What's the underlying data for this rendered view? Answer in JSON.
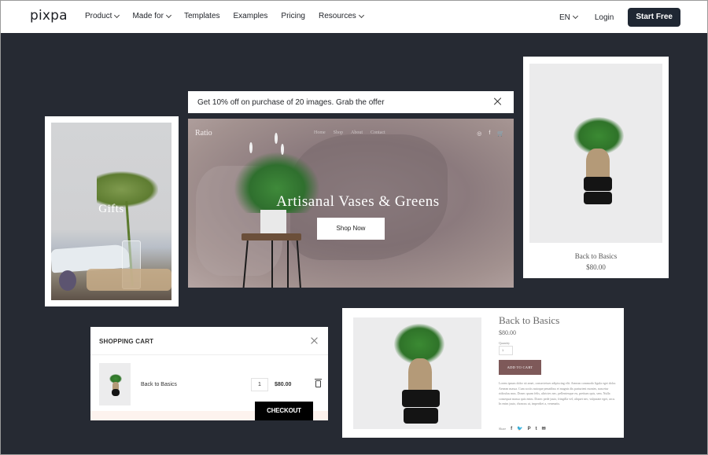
{
  "topnav": {
    "logo": "pixpa",
    "links": [
      {
        "label": "Product",
        "dropdown": true
      },
      {
        "label": "Made for",
        "dropdown": true
      },
      {
        "label": "Templates",
        "dropdown": false
      },
      {
        "label": "Examples",
        "dropdown": false
      },
      {
        "label": "Pricing",
        "dropdown": false
      },
      {
        "label": "Resources",
        "dropdown": true
      }
    ],
    "language": "EN",
    "login": "Login",
    "cta": "Start Free"
  },
  "gifts_card": {
    "label": "Gifts"
  },
  "promo_banner": {
    "text": "Get 10% off on purchase of 20 images. Grab the offer",
    "close_icon": "close-icon"
  },
  "hero": {
    "brand": "Ratio",
    "menu": [
      "Home",
      "Shop",
      "About",
      "Contact"
    ],
    "icons": [
      "instagram-icon",
      "facebook-icon",
      "cart-icon"
    ],
    "icon_glyphs": [
      "◎",
      "f",
      "🛒"
    ],
    "title": "Artisanal Vases & Greens",
    "button": "Shop Now"
  },
  "product_card": {
    "name": "Back to Basics",
    "price": "$80.00"
  },
  "cart": {
    "title": "SHOPPING CART",
    "item": {
      "name": "Back to Basics",
      "quantity": "1",
      "price": "$80.00"
    },
    "checkout": "CHECKOUT"
  },
  "product_detail": {
    "title": "Back to Basics",
    "price": "$80.00",
    "quantity_label": "Quantity",
    "quantity": "1",
    "add_to_cart": "ADD TO CART",
    "description": "Lorem ipsum dolor sit amet, consectetuer adipiscing elit. Aenean commodo ligula eget dolor. Aenean massa. Cum sociis natoque penatibus et magnis dis parturient montes, nascetur ridiculus mus. Donec quam felis, ultricies nec, pellentesque eu, pretium quis, sem. Nulla consequat massa quis enim. Donec pede justo, fringilla vel, aliquet nec, vulputate eget, arcu. In enim justo, rhoncus ut, imperdiet a, venenatis.",
    "share_label": "Share",
    "share_icons": [
      {
        "name": "facebook-icon",
        "glyph": "f"
      },
      {
        "name": "twitter-icon",
        "glyph": "🐦"
      },
      {
        "name": "pinterest-icon",
        "glyph": "P"
      },
      {
        "name": "tumblr-icon",
        "glyph": "t"
      },
      {
        "name": "email-icon",
        "glyph": "✉"
      }
    ]
  },
  "colors": {
    "background": "#262a33",
    "cta_button": "#1f2733",
    "add_to_cart": "#7e5959",
    "checkout": "#000000"
  }
}
